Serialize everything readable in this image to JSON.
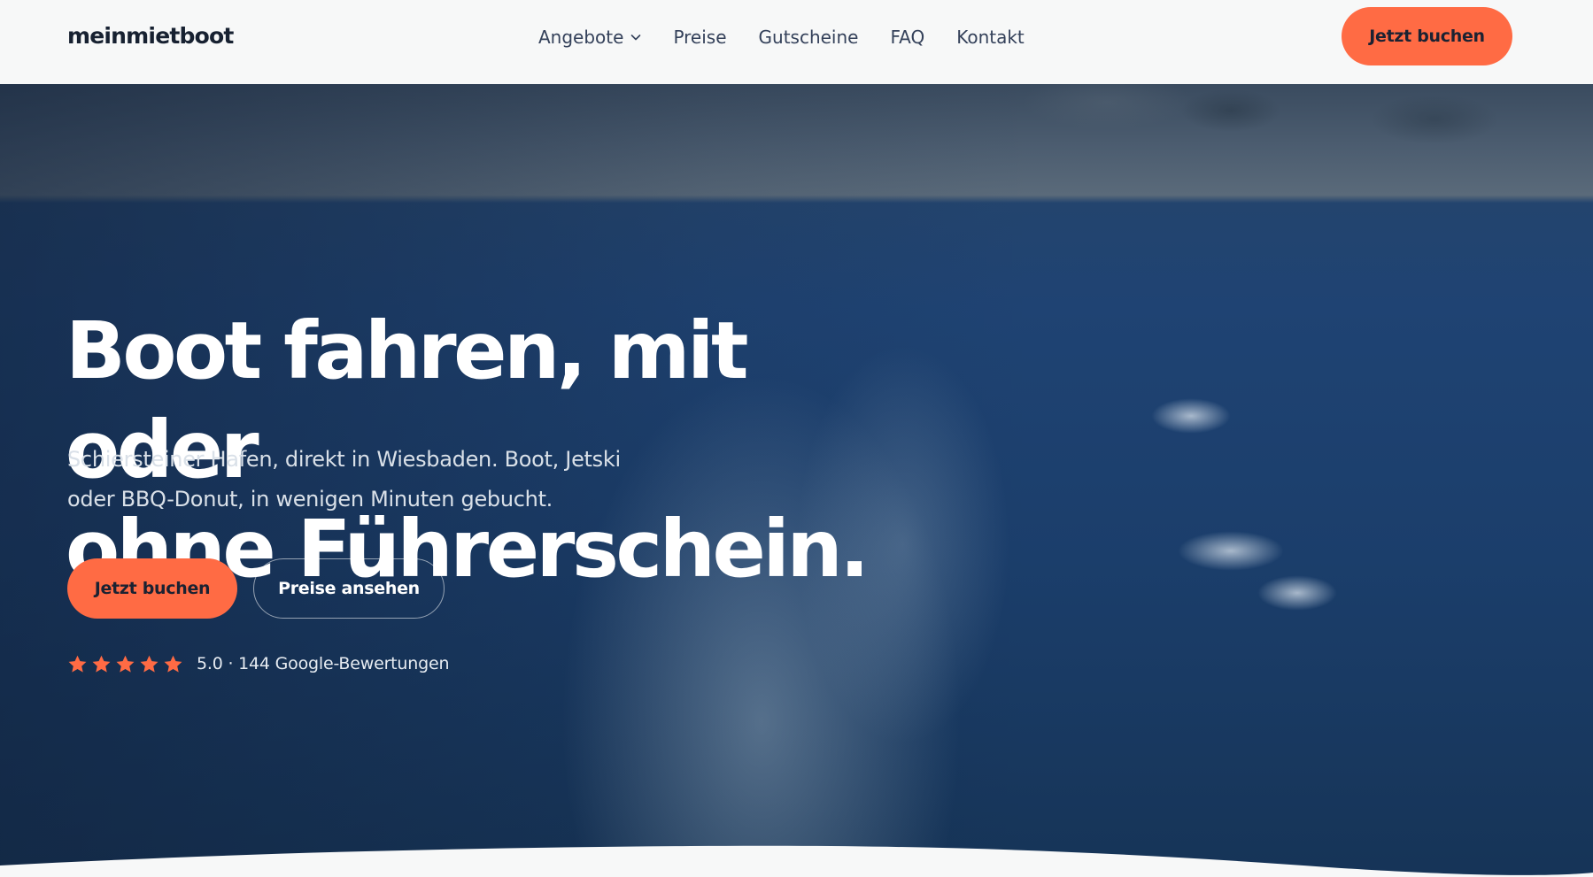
{
  "header": {
    "logo": "meinmietboot",
    "nav": [
      {
        "label": "Angebote",
        "has_dropdown": true
      },
      {
        "label": "Preise"
      },
      {
        "label": "Gutscheine"
      },
      {
        "label": "FAQ"
      },
      {
        "label": "Kontakt"
      }
    ],
    "cta_label": "Jetzt buchen"
  },
  "hero": {
    "headline_line1": "Boot fahren, mit oder",
    "headline_line2": "ohne Führerschein.",
    "subtitle_line1": "Schiersteiner Hafen, direkt in Wiesbaden. Boot, Jetski",
    "subtitle_line2": "oder BBQ-Donut, in wenigen Minuten gebucht.",
    "primary_button": "Jetzt buchen",
    "secondary_button": "Preise ansehen",
    "rating": {
      "stars": 5,
      "text": "5.0 · 144 Google-Bewertungen"
    }
  },
  "colors": {
    "accent": "#ff6b44",
    "header_bg": "#f7f8f8",
    "hero_overlay": "#163457",
    "text_dark": "#172131"
  },
  "icons": {
    "dropdown": "chevron-down-icon",
    "rating": "star-icon"
  }
}
